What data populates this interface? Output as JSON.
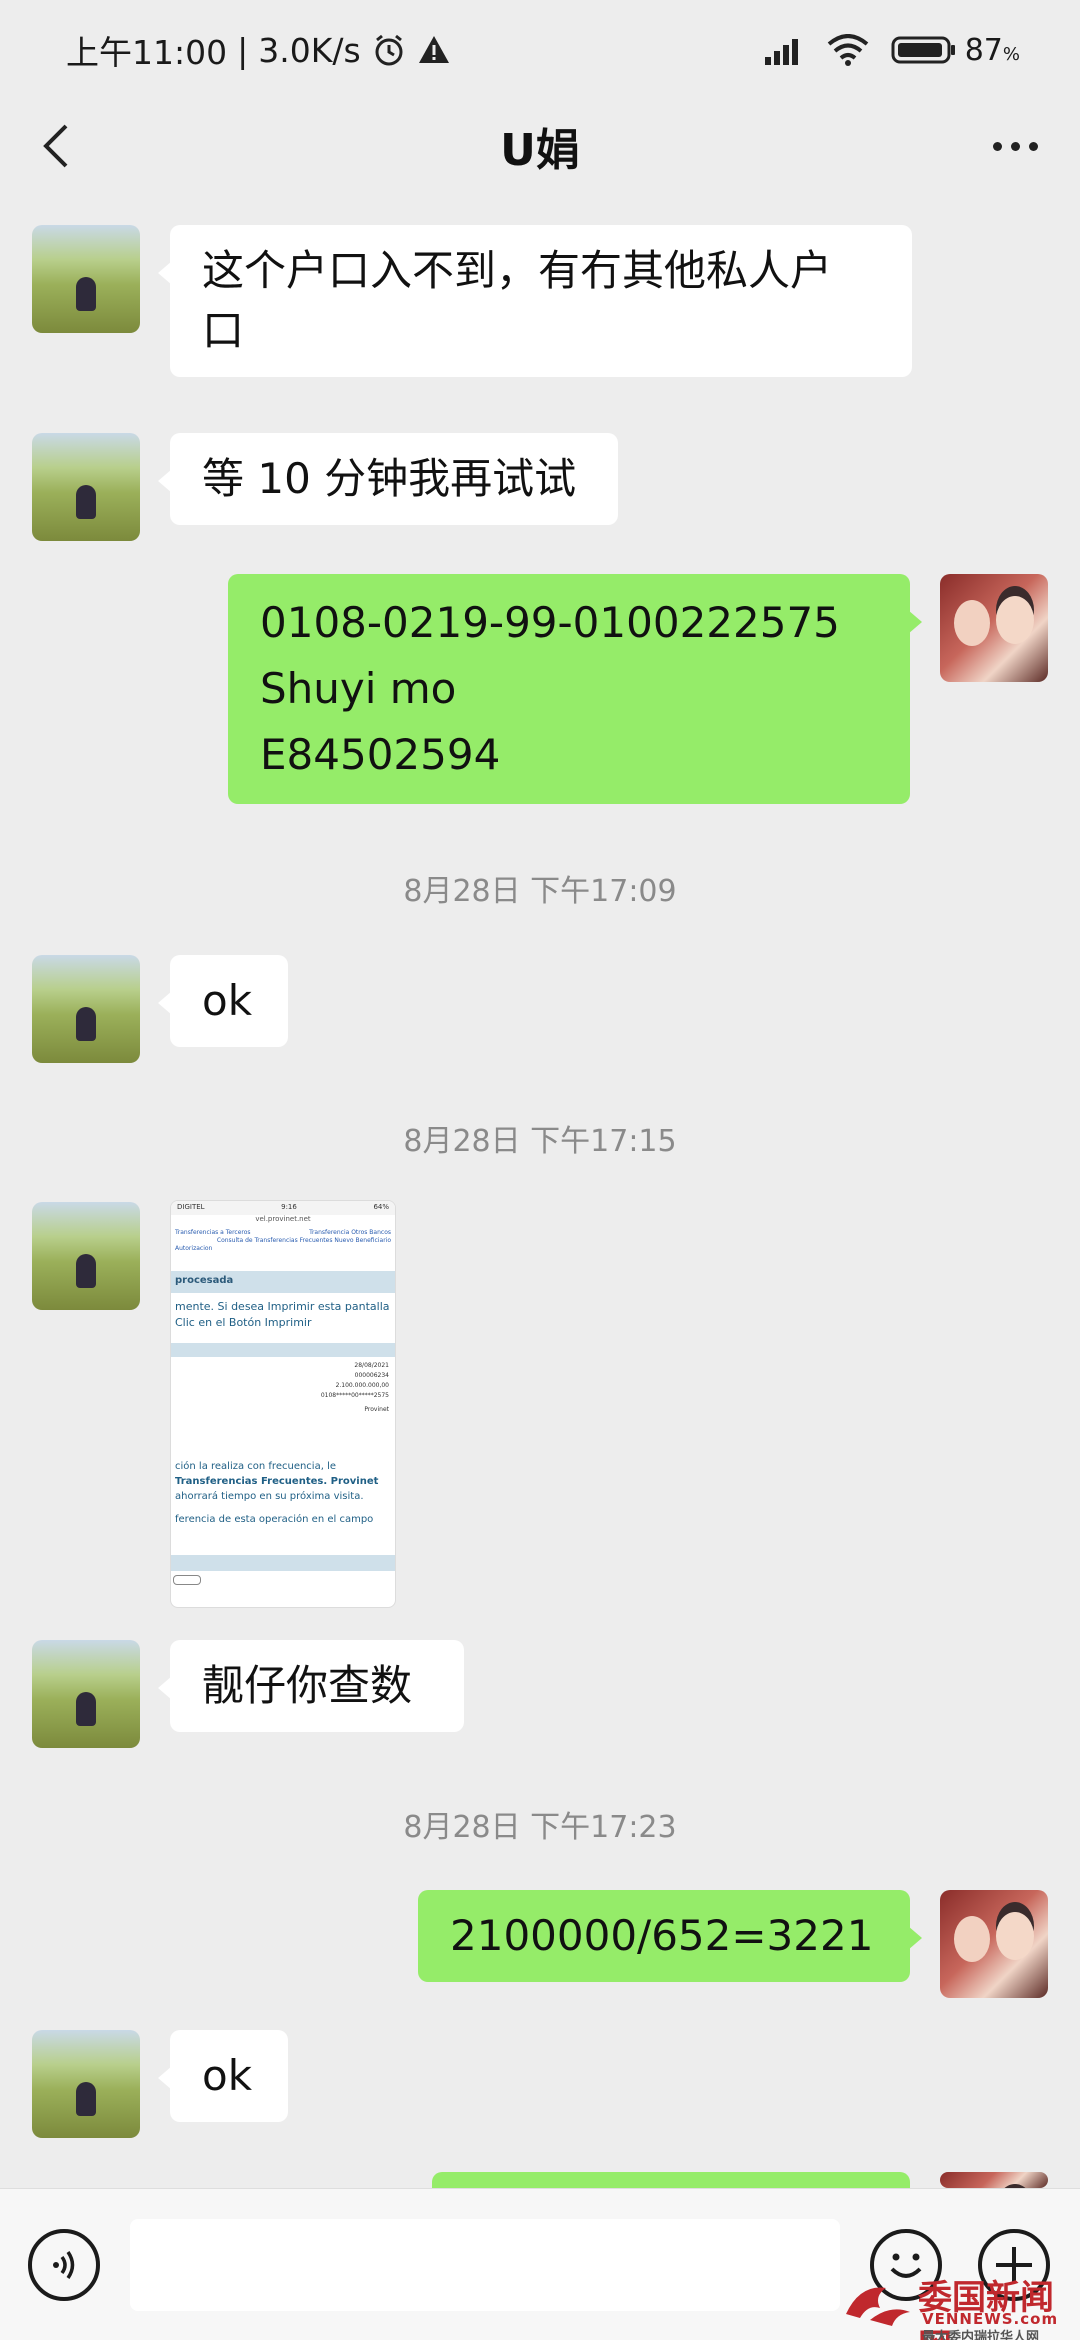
{
  "status_bar": {
    "time": "上午11:00",
    "net_speed": "3.0K/s",
    "battery": "87",
    "battery_unit": "%"
  },
  "header": {
    "title": "U娟"
  },
  "messages": [
    {
      "side": "left",
      "text_lines": [
        "这个户口入不到，有冇其他私人户",
        "口"
      ]
    },
    {
      "side": "left",
      "text_lines": [
        "等 10 分钟我再试试"
      ]
    },
    {
      "side": "right",
      "text_lines": [
        "0108-0219-99-0100222575",
        "Shuyi mo",
        "E84502594"
      ]
    },
    {
      "side": "left",
      "text_lines": [
        "ok"
      ]
    },
    {
      "side": "left",
      "text_lines": [
        "靓仔你查数"
      ]
    },
    {
      "side": "right",
      "text_lines": [
        "2100000/652=3221"
      ]
    },
    {
      "side": "left",
      "text_lines": [
        "ok"
      ]
    }
  ],
  "timestamps": [
    "8月28日 下午17:09",
    "8月28日 下午17:15",
    "8月28日 下午17:23"
  ],
  "image_message": {
    "status_carrier": "DIGITEL",
    "status_time": "9:16",
    "status_battery": "64%",
    "url": "vel.provinet.net",
    "links": [
      "Transferencias a Terceros",
      "Transferencia Otros Bancos",
      "Consulta de Transferencias Frecuentes Nuevo Beneficiario",
      "Autorizacion"
    ],
    "header": "procesada",
    "notice": [
      "mente. Si desea Imprimir esta pantalla",
      "Clic en el Botón Imprimir"
    ],
    "values": [
      "28/08/2021",
      "000006234",
      "2.100.000.000,00",
      "0108*****00*****2575",
      "Provinet"
    ],
    "footer": [
      "ción la realiza con frecuencia, le",
      "Transferencias Frecuentes. Provinet",
      "ahorrará tiempo en su próxima visita.",
      "ferencia de esta operación en el campo"
    ]
  },
  "watermark": {
    "brand": "委国新闻网",
    "site": "VENNEWS.com",
    "tagline": "最大委内瑞拉华人网"
  },
  "colors": {
    "background": "#ededed",
    "sent_bubble": "#95ec69",
    "received_bubble": "#ffffff",
    "timestamp": "#8a8a8a",
    "watermark": "#c0282d"
  },
  "icons": [
    "back-arrow-icon",
    "more-icon",
    "voice-icon",
    "emoji-icon",
    "plus-icon",
    "signal-icon",
    "wifi-icon",
    "alarm-icon",
    "warning-icon",
    "battery-icon"
  ]
}
